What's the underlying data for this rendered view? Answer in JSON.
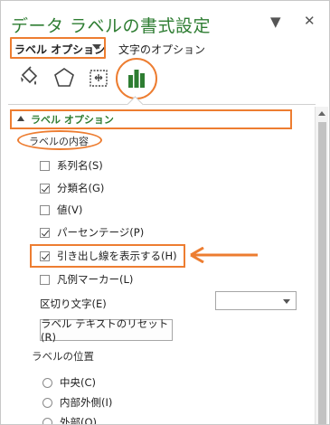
{
  "pane": {
    "title": "データ ラベルの書式設定"
  },
  "controls": {
    "dropdown_glyph": "▼",
    "close_glyph": "✕"
  },
  "tabs": [
    {
      "label": "ラベル オプション"
    },
    {
      "label": "文字のオプション"
    }
  ],
  "section": {
    "label": "ラベル オプション",
    "subsection": "ラベルの内容",
    "checkboxes": [
      {
        "label": "系列名(S)",
        "checked": false
      },
      {
        "label": "分類名(G)",
        "checked": true
      },
      {
        "label": "値(V)",
        "checked": false
      },
      {
        "label": "パーセンテージ(P)",
        "checked": true
      },
      {
        "label": "引き出し線を表示する(H)",
        "checked": true
      },
      {
        "label": "凡例マーカー(L)",
        "checked": false
      }
    ],
    "separator_label": "区切り文字(E)",
    "separator_value": "",
    "reset_button": "ラベル テキストのリセット(R)",
    "position_label": "ラベルの位置",
    "positions": [
      {
        "label": "中央(C)"
      },
      {
        "label": "内部外側(I)"
      },
      {
        "label": "外部(O)"
      }
    ]
  },
  "colors": {
    "accent": "#ed7d31",
    "title": "#2e7d32"
  }
}
